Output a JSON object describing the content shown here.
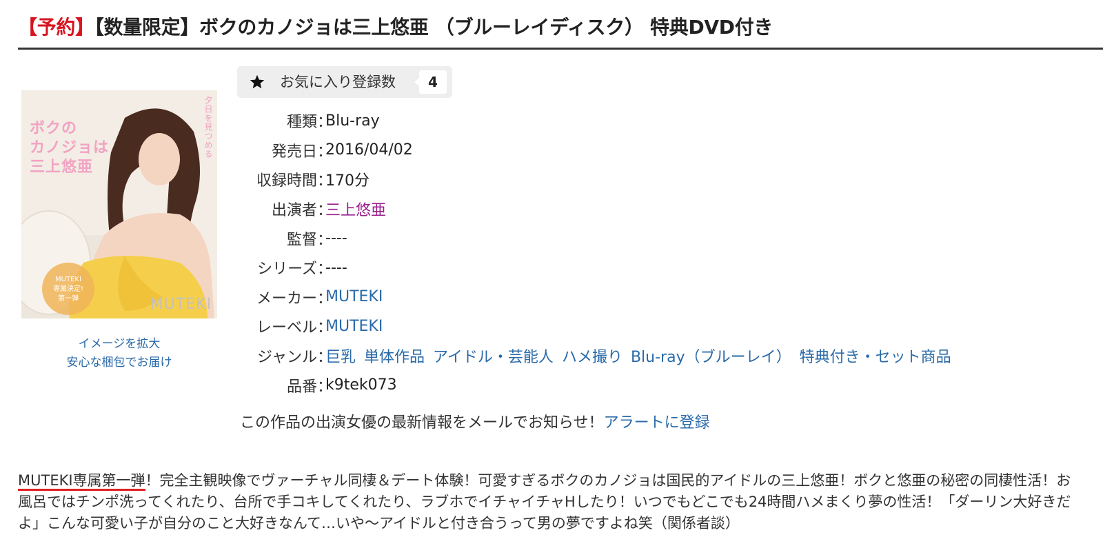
{
  "header": {
    "tag": "【予約】",
    "title": "【数量限定】ボクのカノジョは三上悠亜 （ブルーレイディスク） 特典DVD付き"
  },
  "cover": {
    "title_lines": [
      "ボクの",
      "カノジョは",
      "三上悠亜"
    ],
    "side_text": "夕日を見つめる",
    "pill_text": [
      "MUTEKI",
      "専属決定!",
      "第一弾"
    ],
    "brand": "MUTEKI"
  },
  "image_links": {
    "enlarge": "イメージを拡大",
    "packaging": "安心な梱包でお届け"
  },
  "favorites": {
    "icon": "star-icon",
    "label": "お気に入り登録数",
    "count": "4"
  },
  "spec": {
    "type": {
      "label": "種類",
      "value": "Blu-ray"
    },
    "release": {
      "label": "発売日",
      "value": "2016/04/02"
    },
    "runtime": {
      "label": "収録時間",
      "value": "170分"
    },
    "cast": {
      "label": "出演者",
      "value": "三上悠亜"
    },
    "director": {
      "label": "監督",
      "value": "----"
    },
    "series": {
      "label": "シリーズ",
      "value": "----"
    },
    "maker": {
      "label": "メーカー",
      "value": "MUTEKI"
    },
    "labelname": {
      "label": "レーベル",
      "value": "MUTEKI"
    },
    "genre": {
      "label": "ジャンル",
      "items": [
        "巨乳",
        "単体作品",
        "アイドル・芸能人",
        "ハメ撮り",
        "Blu-ray（ブルーレイ）",
        "特典付き・セット商品"
      ]
    },
    "product_no": {
      "label": "品番",
      "value": "k9tek073"
    },
    "colon": "："
  },
  "alert": {
    "text": "この作品の出演女優の最新情報をメールでお知らせ！",
    "link": "アラートに登録"
  },
  "description": {
    "lead": "MUTEKI専属第一弾",
    "body": "！完全主観映像でヴァーチャル同棲＆デート体験！可愛すぎるボクのカノジョは国民的アイドルの三上悠亜！ボクと悠亜の秘密の同棲性活！お風呂ではチンポ洗ってくれたり、台所で手コキしてくれたり、ラブホでイチャイチャHしたり！いつでもどこでも24時間ハメまくり夢の性活！「ダーリン大好きだよ」こんな可愛い子が自分のこと大好きなんて…いや〜アイドルと付き合うって男の夢ですよね笑（関係者談）"
  },
  "colors": {
    "tag_red": "#d8141f",
    "link_blue": "#2a6aa9",
    "cast_purple": "#9a1f8d",
    "underline_red": "#e0201f"
  }
}
